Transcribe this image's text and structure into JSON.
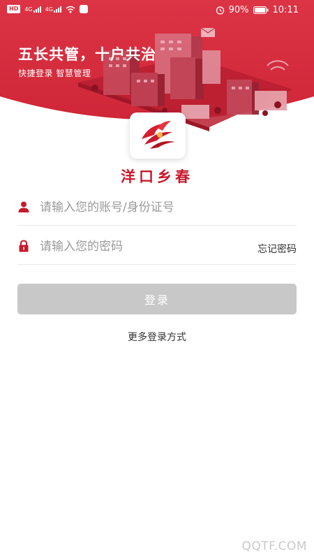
{
  "status_bar": {
    "network_badge": "HD",
    "signal_1": "4G",
    "signal_2": "4G",
    "battery": "90%",
    "time": "10:11"
  },
  "hero": {
    "slogan": "五长共管，十户共治",
    "tagline": "快捷登录 智慧管理"
  },
  "app": {
    "name": "洋口乡春"
  },
  "login_form": {
    "account_placeholder": "请输入您的账号/身份证号",
    "password_placeholder": "请输入您的密码",
    "forgot_password": "忘记密码",
    "login_button": "登录",
    "more_login": "更多登录方式"
  },
  "watermark": "QQTF.COM",
  "colors": {
    "brand_red": "#c8192c",
    "hero_red": "#d42e3f",
    "button_disabled": "#c8c8c8"
  },
  "icons": [
    "user-icon",
    "lock-icon",
    "alarm-icon",
    "battery-icon",
    "wifi-icon",
    "signal-icon",
    "app-logo"
  ]
}
